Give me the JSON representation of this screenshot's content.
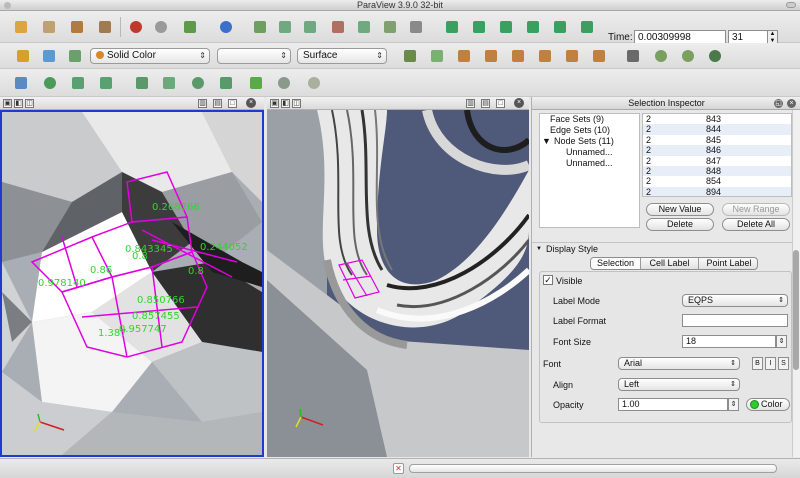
{
  "window": {
    "title": "ParaView 3.9.0 32-bit"
  },
  "toolbar_main": {
    "time_label": "Time:",
    "time_value": "0.00309998",
    "time_step": "31"
  },
  "toolbar_display": {
    "color_by": "Solid Color",
    "component": "",
    "representation": "Surface"
  },
  "viewport_left": {
    "labels": [
      "0.268266",
      "0.843345",
      "0.244052",
      "0.86",
      "0.978140",
      "0.850766",
      "0.857455",
      "0.957747",
      "1.387"
    ]
  },
  "selection_inspector": {
    "title": "Selection Inspector",
    "tree": [
      {
        "label": "Face Sets (9)"
      },
      {
        "label": "Edge Sets (10)"
      },
      {
        "label": "Node Sets (11)"
      },
      {
        "label": "Unnamed..."
      },
      {
        "label": "Unnamed..."
      }
    ],
    "table_rows": [
      {
        "a": "2",
        "b": "843"
      },
      {
        "a": "2",
        "b": "844"
      },
      {
        "a": "2",
        "b": "845"
      },
      {
        "a": "2",
        "b": "846"
      },
      {
        "a": "2",
        "b": "847"
      },
      {
        "a": "2",
        "b": "848"
      },
      {
        "a": "2",
        "b": "854"
      },
      {
        "a": "2",
        "b": "894"
      }
    ],
    "buttons": {
      "new_value": "New Value",
      "new_range": "New Range",
      "delete": "Delete",
      "delete_all": "Delete All"
    },
    "display_style": {
      "header": "Display Style",
      "tabs": [
        "Selection",
        "Cell Label",
        "Point Label"
      ],
      "visible_label": "Visible",
      "label_mode_label": "Label Mode",
      "label_mode_value": "EQPS",
      "label_format_label": "Label Format",
      "label_format_value": "",
      "font_size_label": "Font Size",
      "font_size_value": "18",
      "font_label": "Font",
      "font_value": "Arial",
      "font_style_buttons": [
        "B",
        "I",
        "S"
      ],
      "align_label": "Align",
      "align_value": "Left",
      "opacity_label": "Opacity",
      "opacity_value": "1.00",
      "color_label": "Color",
      "color_swatch": "#2ecc2e"
    }
  },
  "colors": {
    "selection_highlight": "#e000e0",
    "label_green": "#2fd52f",
    "active_view_border": "#1f3ad0"
  }
}
